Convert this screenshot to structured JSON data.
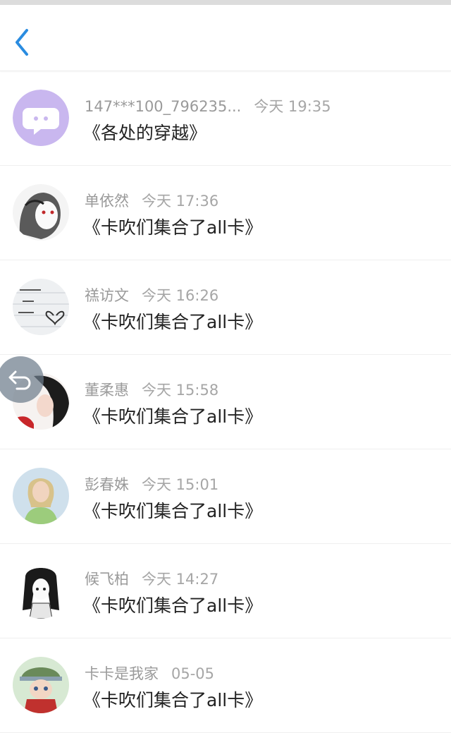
{
  "header": {
    "back_icon": "chevron-left-icon",
    "accent_color": "#2a8ce0"
  },
  "conversations": [
    {
      "name": "147***100_796235...",
      "time": "今天 19:35",
      "message": "《各处的穿越》",
      "avatar": "purple-chat-bubble-icon"
    },
    {
      "name": "单依然",
      "time": "今天 17:36",
      "message": "《卡吹们集合了all卡》",
      "avatar": "sketch-portrait"
    },
    {
      "name": "禚访文",
      "time": "今天 16:26",
      "message": "《卡吹们集合了all卡》",
      "avatar": "handwritten-note-heart"
    },
    {
      "name": "董柔惠",
      "time": "今天 15:58",
      "message": "《卡吹们集合了all卡》",
      "avatar": "dark-hair-portrait"
    },
    {
      "name": "彭春姝",
      "time": "今天 15:01",
      "message": "《卡吹们集合了all卡》",
      "avatar": "blonde-woman-photo"
    },
    {
      "name": "候飞柏",
      "time": "今天 14:27",
      "message": "《卡吹们集合了all卡》",
      "avatar": "anime-girl-sketch"
    },
    {
      "name": "卡卡是我家",
      "time": "05-05",
      "message": "《卡吹们集合了all卡》",
      "avatar": "anime-character-hat"
    }
  ],
  "floating_button": {
    "icon": "return-arrow-icon"
  }
}
